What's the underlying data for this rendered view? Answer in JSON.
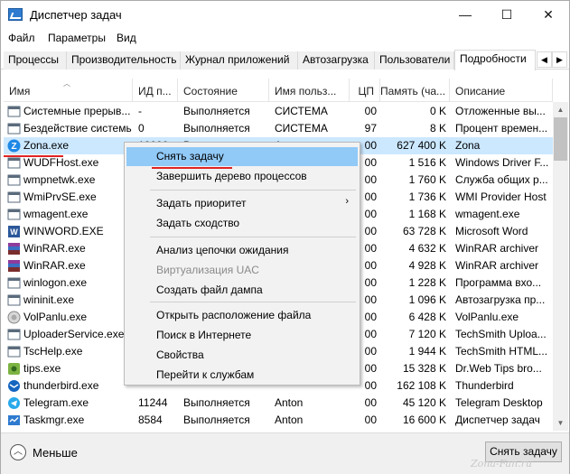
{
  "window": {
    "title": "Диспетчер задач",
    "min_glyph": "—",
    "max_glyph": "☐",
    "close_glyph": "✕"
  },
  "menubar": [
    "Файл",
    "Параметры",
    "Вид"
  ],
  "tabs": [
    "Процессы",
    "Производительность",
    "Журнал приложений",
    "Автозагрузка",
    "Пользователи",
    "Подробности"
  ],
  "active_tab": "Подробности",
  "tab_arrows": {
    "left": "◀",
    "right": "▶"
  },
  "columns": [
    "Имя",
    "ИД п...",
    "Состояние",
    "Имя польз...",
    "ЦП",
    "Память (ча...",
    "Описание"
  ],
  "rows": [
    {
      "name": "Системные прерыв...",
      "pid": "-",
      "status": "Выполняется",
      "user": "СИСТЕМА",
      "cpu": "00",
      "mem": "0 K",
      "desc": "Отложенные вы...",
      "icon": "window-icon"
    },
    {
      "name": "Бездействие системы",
      "pid": "0",
      "status": "Выполняется",
      "user": "СИСТЕМА",
      "cpu": "97",
      "mem": "8 K",
      "desc": "Процент времен...",
      "icon": "window-icon"
    },
    {
      "name": "Zona.exe",
      "pid": "10000",
      "status": "Выполняется",
      "user": "Anton",
      "cpu": "00",
      "mem": "627 400 K",
      "desc": "Zona",
      "icon": "zona-icon",
      "selected": true
    },
    {
      "name": "WUDFHost.exe",
      "pid": "",
      "status": "",
      "user": "",
      "cpu": "00",
      "mem": "1 516 K",
      "desc": "Windows Driver F...",
      "icon": "window-icon"
    },
    {
      "name": "wmpnetwk.exe",
      "pid": "",
      "status": "",
      "user": "",
      "cpu": "00",
      "mem": "1 760 K",
      "desc": "Служба общих р...",
      "icon": "window-icon"
    },
    {
      "name": "WmiPrvSE.exe",
      "pid": "",
      "status": "",
      "user": "",
      "cpu": "00",
      "mem": "1 736 K",
      "desc": "WMI Provider Host",
      "icon": "window-icon"
    },
    {
      "name": "wmagent.exe",
      "pid": "",
      "status": "",
      "user": "",
      "cpu": "00",
      "mem": "1 168 K",
      "desc": "wmagent.exe",
      "icon": "window-icon"
    },
    {
      "name": "WINWORD.EXE",
      "pid": "",
      "status": "",
      "user": "",
      "cpu": "00",
      "mem": "63 728 K",
      "desc": "Microsoft Word",
      "icon": "word-icon"
    },
    {
      "name": "WinRAR.exe",
      "pid": "",
      "status": "",
      "user": "",
      "cpu": "00",
      "mem": "4 632 K",
      "desc": "WinRAR archiver",
      "icon": "winrar-icon"
    },
    {
      "name": "WinRAR.exe",
      "pid": "",
      "status": "",
      "user": "",
      "cpu": "00",
      "mem": "4 928 K",
      "desc": "WinRAR archiver",
      "icon": "winrar-icon"
    },
    {
      "name": "winlogon.exe",
      "pid": "",
      "status": "",
      "user": "",
      "cpu": "00",
      "mem": "1 228 K",
      "desc": "Программа вхо...",
      "icon": "window-icon"
    },
    {
      "name": "wininit.exe",
      "pid": "",
      "status": "",
      "user": "",
      "cpu": "00",
      "mem": "1 096 K",
      "desc": "Автозагрузка пр...",
      "icon": "window-icon"
    },
    {
      "name": "VolPanlu.exe",
      "pid": "",
      "status": "",
      "user": "",
      "cpu": "00",
      "mem": "6 428 K",
      "desc": "VolPanlu.exe",
      "icon": "volume-icon"
    },
    {
      "name": "UploaderService.exe",
      "pid": "",
      "status": "",
      "user": "",
      "cpu": "00",
      "mem": "7 120 K",
      "desc": "TechSmith Uploa...",
      "icon": "window-icon"
    },
    {
      "name": "TscHelp.exe",
      "pid": "",
      "status": "",
      "user": "",
      "cpu": "00",
      "mem": "1 944 K",
      "desc": "TechSmith HTML...",
      "icon": "window-icon"
    },
    {
      "name": "tips.exe",
      "pid": "",
      "status": "",
      "user": "",
      "cpu": "00",
      "mem": "15 328 K",
      "desc": "Dr.Web Tips bro...",
      "icon": "drweb-icon"
    },
    {
      "name": "thunderbird.exe",
      "pid": "",
      "status": "",
      "user": "",
      "cpu": "00",
      "mem": "162 108 K",
      "desc": "Thunderbird",
      "icon": "thunderbird-icon"
    },
    {
      "name": "Telegram.exe",
      "pid": "11244",
      "status": "Выполняется",
      "user": "Anton",
      "cpu": "00",
      "mem": "45 120 K",
      "desc": "Telegram Desktop",
      "icon": "telegram-icon"
    },
    {
      "name": "Taskmgr.exe",
      "pid": "8584",
      "status": "Выполняется",
      "user": "Anton",
      "cpu": "00",
      "mem": "16 600 K",
      "desc": "Диспетчер задач",
      "icon": "taskmgr-icon"
    }
  ],
  "context_menu": {
    "items": [
      {
        "label": "Снять задачу",
        "highlighted": true
      },
      {
        "label": "Завершить дерево процессов"
      },
      {
        "label": "Задать приоритет",
        "submenu": true
      },
      {
        "label": "Задать сходство"
      },
      {
        "label": "Анализ цепочки ожидания"
      },
      {
        "label": "Виртуализация UAC",
        "disabled": true
      },
      {
        "label": "Создать файл дампа"
      },
      {
        "label": "Открыть расположение файла"
      },
      {
        "label": "Поиск в Интернете"
      },
      {
        "label": "Свойства"
      },
      {
        "label": "Перейти к службам"
      }
    ],
    "submenu_arrow": "›"
  },
  "footer": {
    "less_label": "Меньше",
    "less_icon_glyph": "︿",
    "end_task_button": "Снять задачу"
  },
  "scroll_arrows": {
    "up": "▲",
    "down": "▼"
  },
  "watermark": "Zona-Fan.ru",
  "colors": {
    "selection": "#cce8ff",
    "menu_highlight": "#91c9f7",
    "annotation_red": "#e02424"
  }
}
